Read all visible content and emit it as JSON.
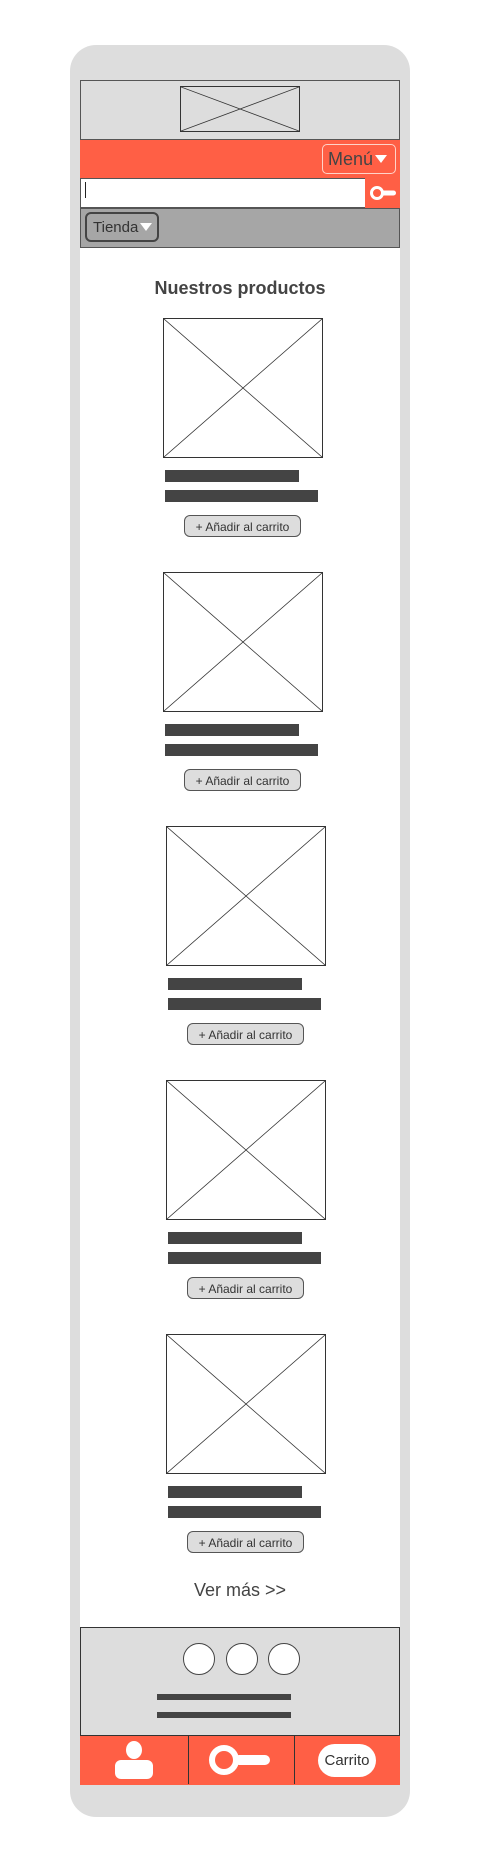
{
  "header": {
    "logo": "logo-placeholder",
    "menu_label": "Menú"
  },
  "search": {
    "value": ""
  },
  "filter": {
    "shop_label": "Tienda"
  },
  "products": {
    "title": "Nuestros productos",
    "items": [
      {
        "image": "image-placeholder",
        "button_label": "+ Añadir al carrito"
      },
      {
        "image": "image-placeholder",
        "button_label": "+ Añadir al carrito"
      },
      {
        "image": "image-placeholder",
        "button_label": "+ Añadir al carrito"
      },
      {
        "image": "image-placeholder",
        "button_label": "+ Añadir al carrito"
      },
      {
        "image": "image-placeholder",
        "button_label": "+ Añadir al carrito"
      }
    ],
    "more_label": "Ver más >>"
  },
  "tabbar": {
    "account_icon": "user-icon",
    "search_icon": "search-icon",
    "cart_label": "Carrito"
  },
  "colors": {
    "accent": "#ff5f45",
    "frame": "#dddddd",
    "filter": "#a6a6a6",
    "ink": "#444444"
  }
}
